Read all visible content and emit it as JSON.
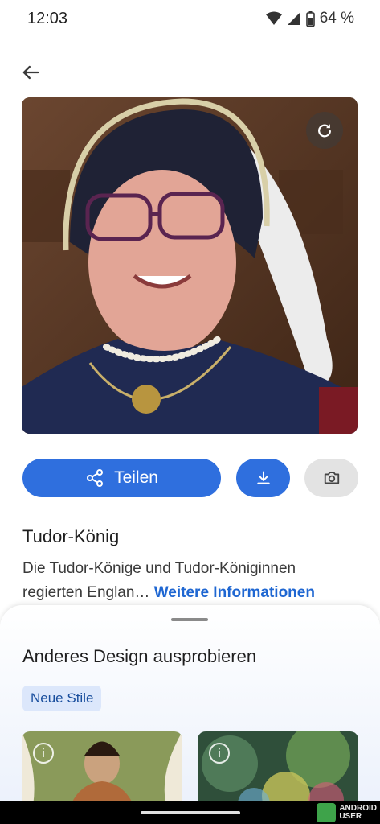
{
  "status_bar": {
    "time": "12:03",
    "battery": "64 %"
  },
  "actions": {
    "share_label": "Teilen"
  },
  "result": {
    "title": "Tudor-König",
    "description": "Die Tudor-Könige und Tudor-Königinnen regierten Englan…",
    "more_link": "Weitere Informationen"
  },
  "sheet": {
    "title": "Anderes Design ausprobieren",
    "chip": "Neue Stile",
    "info_glyph": "i"
  },
  "watermark": {
    "line1": "ANDROID",
    "line2": "USER"
  },
  "icons": {
    "back": "arrow-left-icon",
    "refresh": "refresh-icon",
    "share": "share-icon",
    "download": "download-icon",
    "camera": "camera-icon"
  },
  "colors": {
    "primary": "#2f6fde",
    "link": "#1f67d2",
    "chip_bg": "#dce7fb"
  }
}
